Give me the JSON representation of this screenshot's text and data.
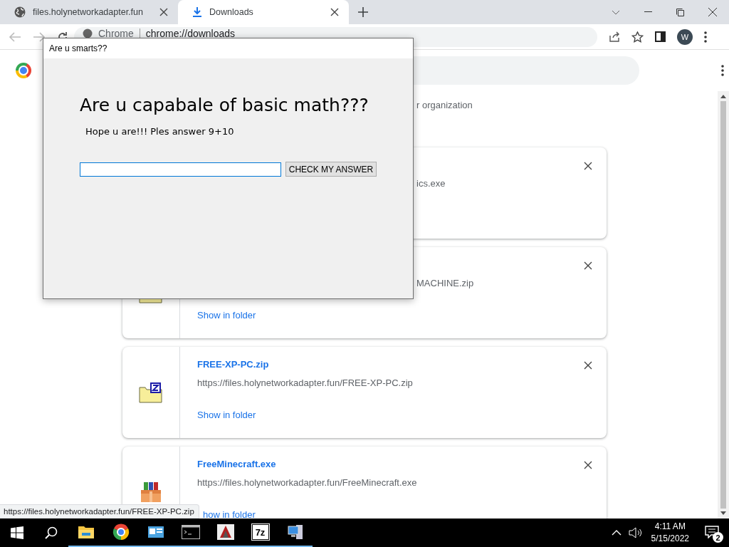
{
  "browser": {
    "tabs": [
      {
        "title": "files.holynetworkadapter.fun",
        "kind": "site",
        "selected": false
      },
      {
        "title": "Downloads",
        "kind": "download",
        "selected": true
      }
    ],
    "address_site": "Chrome",
    "address_url": "chrome://downloads",
    "profile_initial": "W"
  },
  "page": {
    "managed_notice": "r organization",
    "downloads": [
      {
        "kind": "covered",
        "url": "ics.exe"
      },
      {
        "kind": "covered-zip",
        "url": "MACHINE.zip",
        "action": "Show in folder"
      },
      {
        "kind": "zip",
        "name": "FREE-XP-PC.zip",
        "url": "https://files.holynetworkadapter.fun/FREE-XP-PC.zip",
        "action": "Show in folder"
      },
      {
        "kind": "installer",
        "name": "FreeMinecraft.exe",
        "url": "https://files.holynetworkadapter.fun/FreeMinecraft.exe",
        "action": "how in folder"
      }
    ]
  },
  "status_url": "https://files.holynetworkadapter.fun/FREE-XP-PC.zip",
  "dialog": {
    "title": "Are u smarts??",
    "heading": "Are u capabale of basic math???",
    "prompt": "Hope u are!!! Ples answer 9+10",
    "button": "CHECK MY ANSWER"
  },
  "taskbar": {
    "apps": [
      {
        "kind": "explorer",
        "running": true
      },
      {
        "kind": "browser",
        "running": true
      },
      {
        "kind": "control",
        "running": true
      },
      {
        "kind": "terminal",
        "running": true
      },
      {
        "kind": "setup",
        "running": true
      },
      {
        "kind": "archiver",
        "label": "7z",
        "running": true
      },
      {
        "kind": "computer",
        "running": true
      }
    ],
    "time": "4:11 AM",
    "date": "5/15/2022",
    "notifications": "2"
  }
}
